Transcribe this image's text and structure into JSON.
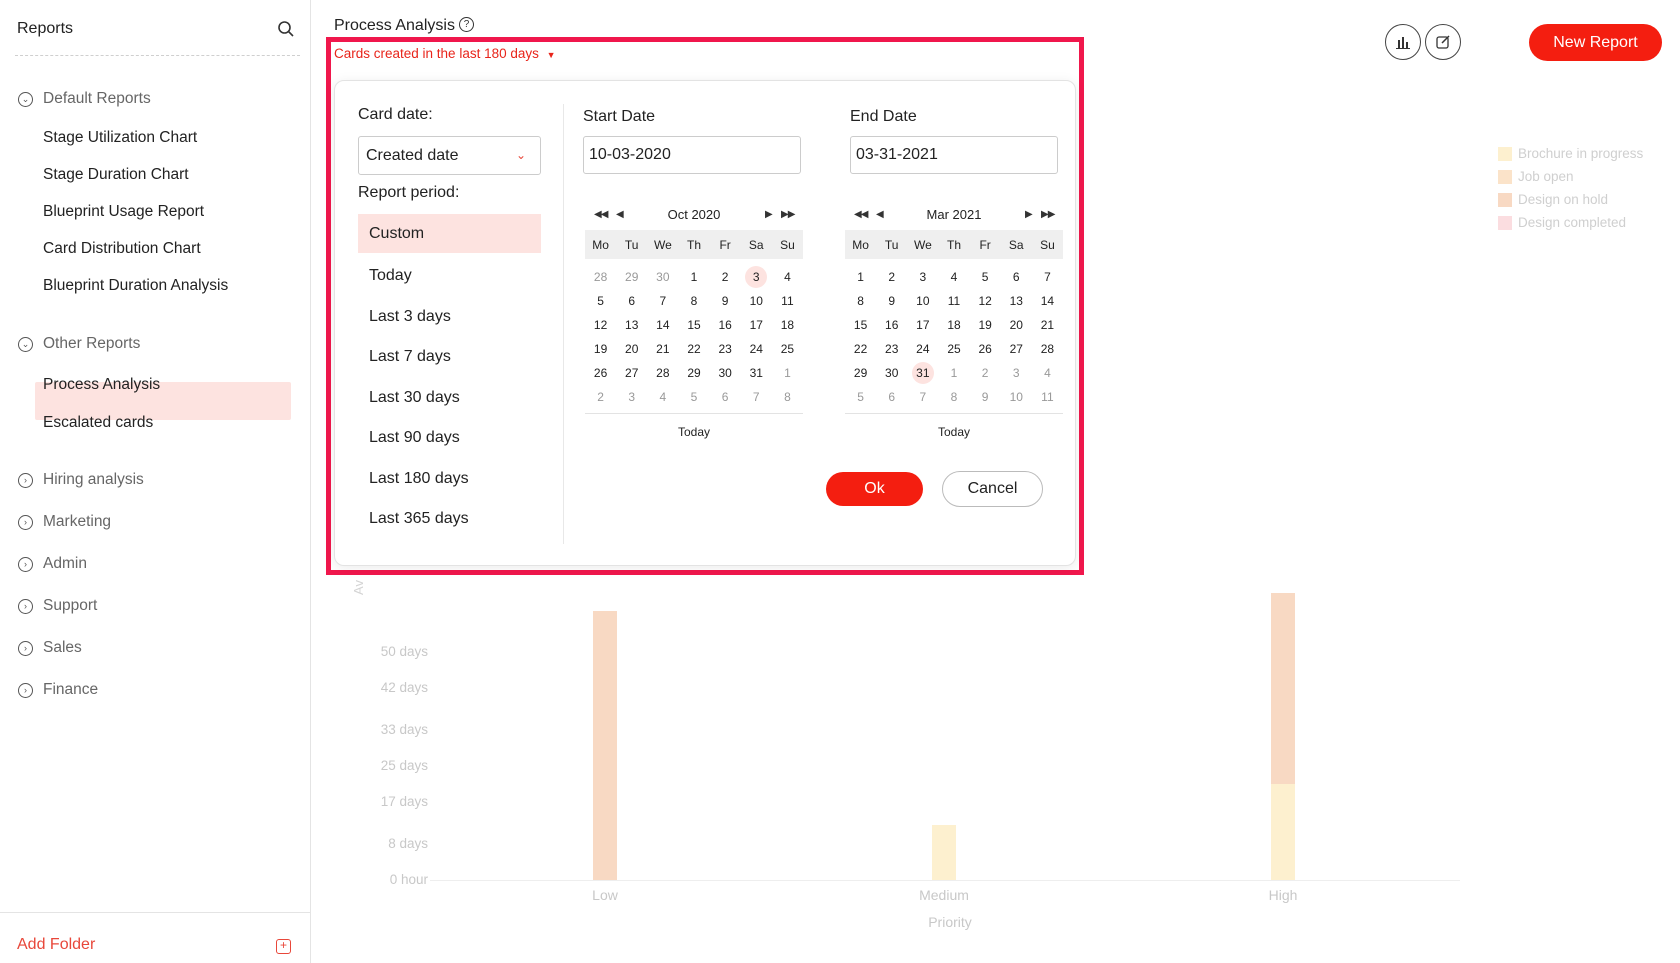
{
  "sidebar": {
    "title": "Reports",
    "default_reports": {
      "label": "Default Reports",
      "items": [
        "Stage Utilization Chart",
        "Stage Duration Chart",
        "Blueprint Usage Report",
        "Card Distribution Chart",
        "Blueprint Duration Analysis"
      ]
    },
    "other_reports": {
      "label": "Other Reports",
      "items": [
        "Process Analysis",
        "Escalated cards"
      ]
    },
    "folders": [
      "Hiring analysis",
      "Marketing",
      "Admin",
      "Support",
      "Sales",
      "Finance"
    ],
    "add_folder": "Add Folder"
  },
  "header": {
    "title": "Process Analysis",
    "new_report": "New Report",
    "filter_label": "Cards created in the last 180 days"
  },
  "popover": {
    "card_date_label": "Card date:",
    "card_date_value": "Created date",
    "report_period_label": "Report period:",
    "periods": [
      "Custom",
      "Today",
      "Last 3 days",
      "Last 7 days",
      "Last 30 days",
      "Last 90 days",
      "Last 180 days",
      "Last 365 days"
    ],
    "selected_period": "Custom",
    "start_label": "Start Date",
    "start_value": "10-03-2020",
    "end_label": "End Date",
    "end_value": "03-31-2021",
    "dow": [
      "Mo",
      "Tu",
      "We",
      "Th",
      "Fr",
      "Sa",
      "Su"
    ],
    "start_cal": {
      "month": "Oct 2020",
      "days": [
        "28",
        "29",
        "30",
        "1",
        "2",
        "3",
        "4",
        "5",
        "6",
        "7",
        "8",
        "9",
        "10",
        "11",
        "12",
        "13",
        "14",
        "15",
        "16",
        "17",
        "18",
        "19",
        "20",
        "21",
        "22",
        "23",
        "24",
        "25",
        "26",
        "27",
        "28",
        "29",
        "30",
        "31",
        "1",
        "2",
        "3",
        "4",
        "5",
        "6",
        "7",
        "8"
      ],
      "muted": [
        0,
        1,
        2,
        34,
        35,
        36,
        37,
        38,
        39,
        40,
        41
      ],
      "selected": 5,
      "today": "Today"
    },
    "end_cal": {
      "month": "Mar 2021",
      "days": [
        "1",
        "2",
        "3",
        "4",
        "5",
        "6",
        "7",
        "8",
        "9",
        "10",
        "11",
        "12",
        "13",
        "14",
        "15",
        "16",
        "17",
        "18",
        "19",
        "20",
        "21",
        "22",
        "23",
        "24",
        "25",
        "26",
        "27",
        "28",
        "29",
        "30",
        "31",
        "1",
        "2",
        "3",
        "4",
        "5",
        "6",
        "7",
        "8",
        "9",
        "10",
        "11"
      ],
      "muted": [
        31,
        32,
        33,
        34,
        35,
        36,
        37,
        38,
        39,
        40,
        41
      ],
      "selected": 30,
      "today": "Today"
    },
    "ok": "Ok",
    "cancel": "Cancel"
  },
  "chart_data": {
    "type": "bar",
    "categories": [
      "Low",
      "Medium",
      "High"
    ],
    "xlabel": "Priority",
    "ylabel": "Av",
    "y_ticks": [
      "0 hour",
      "8 days",
      "17 days",
      "25 days",
      "33 days",
      "42 days",
      "50 days"
    ],
    "series": [
      {
        "name": "Brochure in progress",
        "color": "#fdf0cf",
        "values": [
          0,
          12,
          21
        ]
      },
      {
        "name": "Job open",
        "color": "#fbe3c9",
        "values": [
          0,
          0,
          0
        ]
      },
      {
        "name": "Design on hold",
        "color": "#f8d9c3",
        "values": [
          59,
          0,
          42
        ]
      },
      {
        "name": "Design completed",
        "color": "#fbdde0",
        "values": [
          0,
          0,
          0
        ]
      }
    ]
  }
}
